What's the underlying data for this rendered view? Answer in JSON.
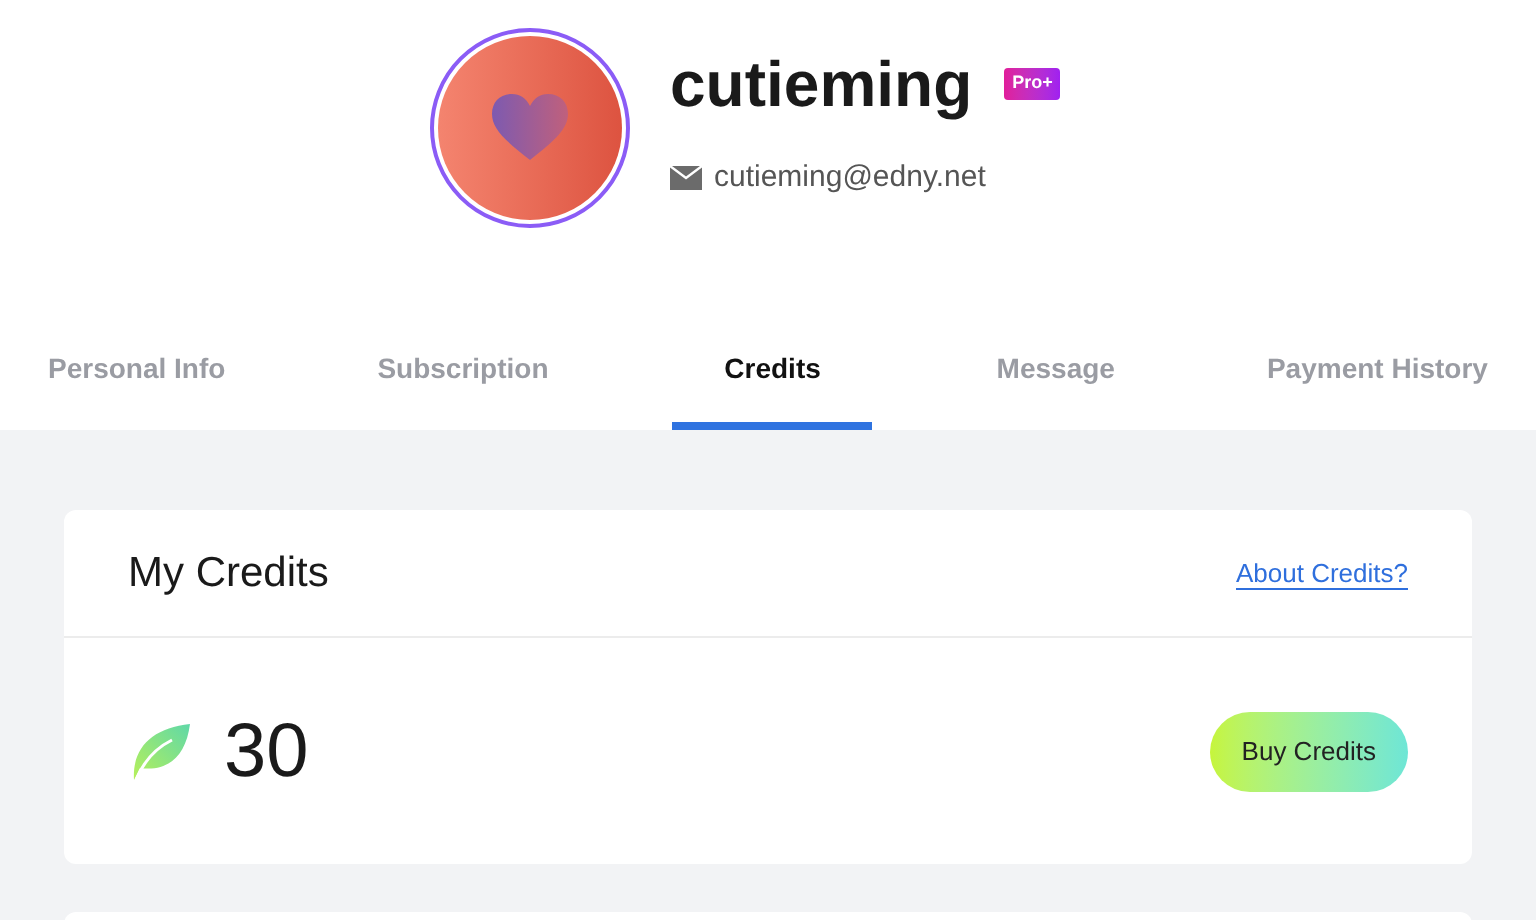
{
  "profile": {
    "username": "cutieming",
    "badge": "Pro+",
    "email": "cutieming@edny.net"
  },
  "tabs": [
    {
      "label": "Personal Info",
      "selected": false
    },
    {
      "label": "Subscription",
      "selected": false
    },
    {
      "label": "Credits",
      "selected": true
    },
    {
      "label": "Message",
      "selected": false
    },
    {
      "label": "Payment History",
      "selected": false
    }
  ],
  "credits_card": {
    "title": "My Credits",
    "link": "About Credits?",
    "amount": "30",
    "button": "Buy Credits"
  }
}
